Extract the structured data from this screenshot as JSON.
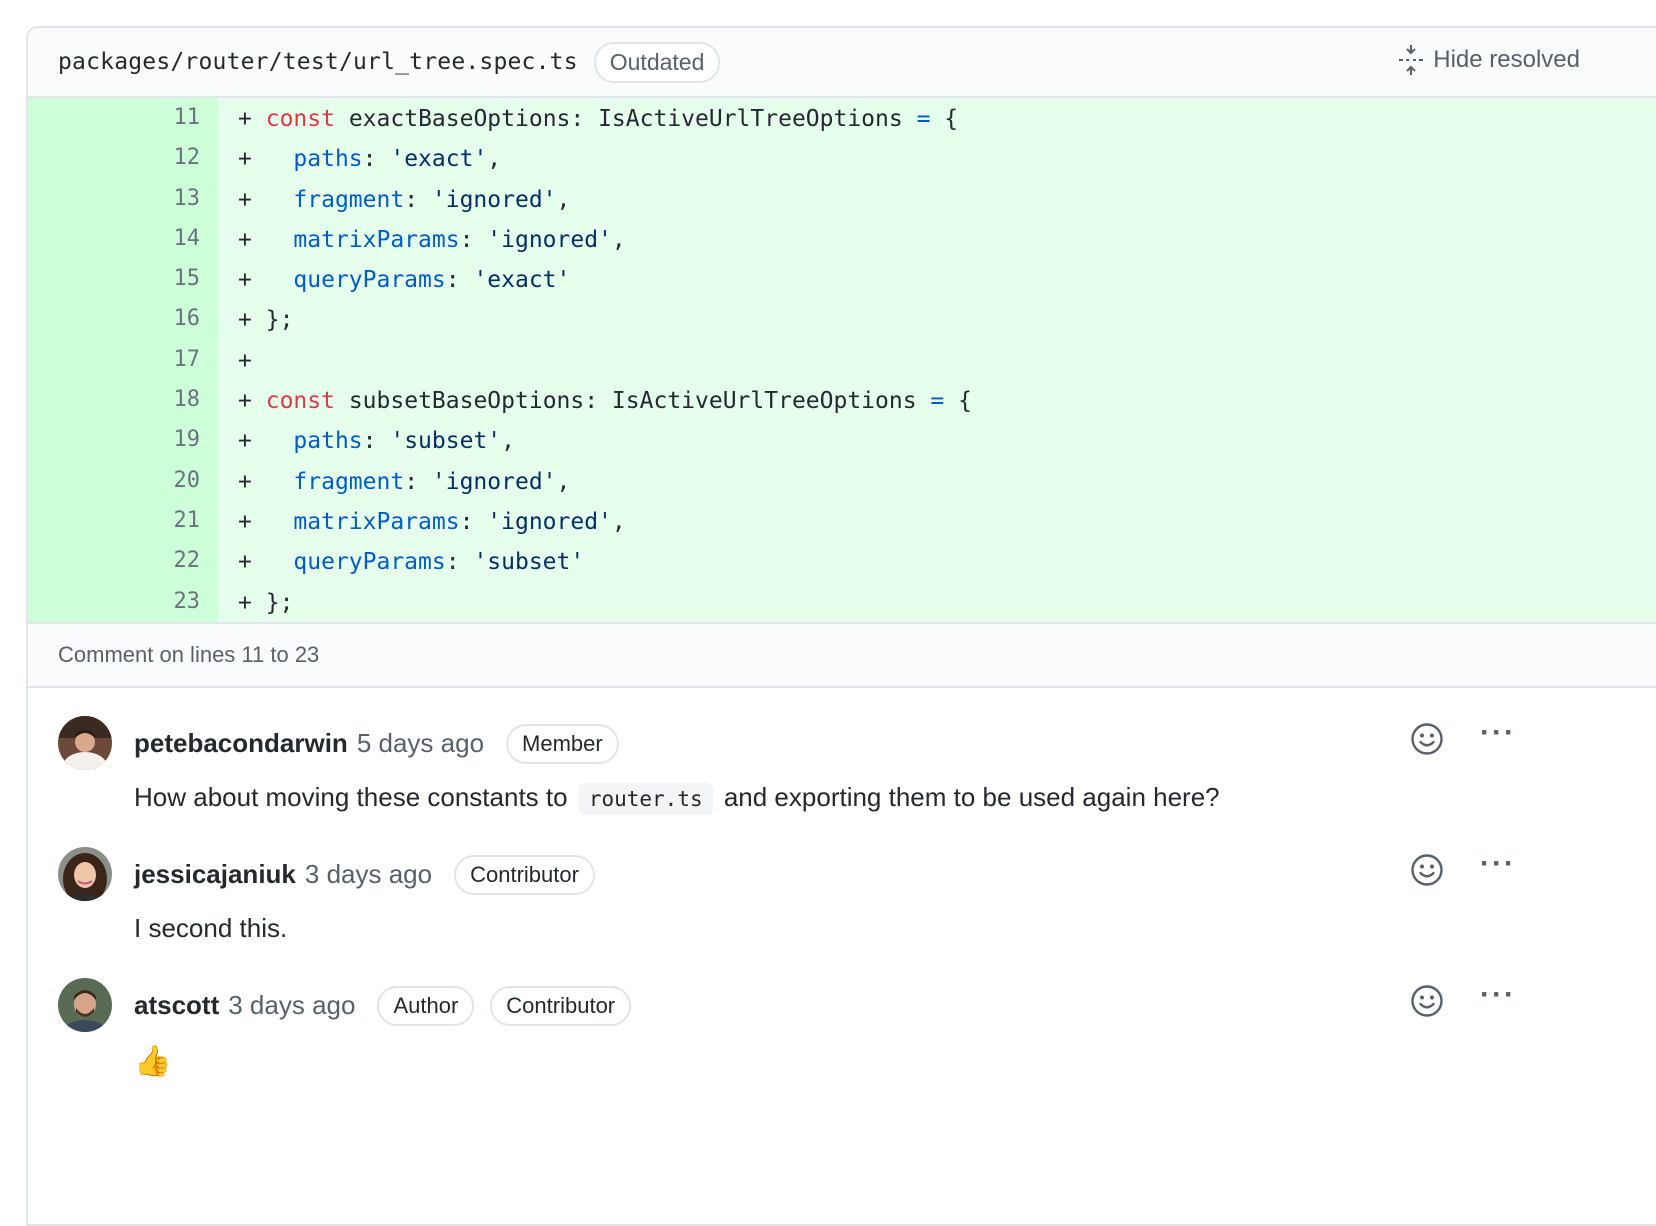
{
  "file": {
    "path": "packages/router/test/url_tree.spec.ts",
    "badge": "Outdated",
    "hide_resolved_label": "Hide resolved"
  },
  "code_lines": [
    {
      "n": "11"
    },
    {
      "n": "12"
    },
    {
      "n": "13"
    },
    {
      "n": "14"
    },
    {
      "n": "15"
    },
    {
      "n": "16"
    },
    {
      "n": "17"
    },
    {
      "n": "18"
    },
    {
      "n": "19"
    },
    {
      "n": "20"
    },
    {
      "n": "21"
    },
    {
      "n": "22"
    },
    {
      "n": "23"
    }
  ],
  "code": {
    "plus": "+",
    "const": "const",
    "l11_name": "exactBaseOptions",
    "l18_name": "subsetBaseOptions",
    "type_decl": ": IsActiveUrlTreeOptions ",
    "eq": "=",
    "brace_open": " {",
    "paths": "paths",
    "fragment": "fragment",
    "matrixParams": "matrixParams",
    "queryParams": "queryParams",
    "colon": ": ",
    "exact": "'exact'",
    "subset": "'subset'",
    "ignored": "'ignored'",
    "comma": ",",
    "close": "};"
  },
  "comment_on": "Comment on lines 11 to 23",
  "comments": [
    {
      "author": "petebacondarwin",
      "time": "5 days ago",
      "roles": [
        "Member"
      ],
      "body_pre": "How about moving these constants to ",
      "body_code": "router.ts",
      "body_post": " and exporting them to be used again here?"
    },
    {
      "author": "jessicajaniuk",
      "time": "3 days ago",
      "roles": [
        "Contributor"
      ],
      "body": "I second this."
    },
    {
      "author": "atscott",
      "time": "3 days ago",
      "roles": [
        "Author",
        "Contributor"
      ],
      "body": "👍"
    }
  ],
  "icons": {
    "more": "···"
  },
  "colors": {
    "addition_bg": "#e6ffed",
    "addition_gutter": "#cdffd8",
    "keyword": "#d73a49",
    "property": "#005cc5",
    "string": "#032f62"
  }
}
